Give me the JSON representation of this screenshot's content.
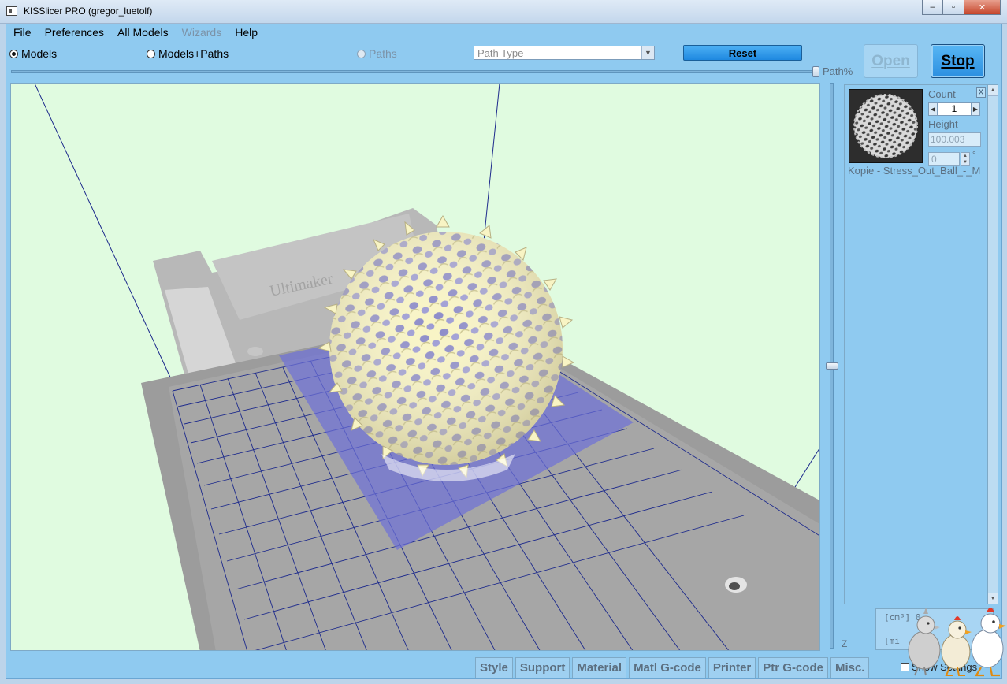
{
  "window": {
    "title": "KISSlicer PRO (gregor_luetolf)",
    "min_glyph": "‒",
    "max_glyph": "▫",
    "close_glyph": "✕"
  },
  "menu": [
    {
      "label": "File",
      "enabled": true
    },
    {
      "label": "Preferences",
      "enabled": true
    },
    {
      "label": "All Models",
      "enabled": true
    },
    {
      "label": "Wizards",
      "enabled": false
    },
    {
      "label": "Help",
      "enabled": true
    }
  ],
  "toolbar": {
    "radio_models": "Models",
    "radio_models_paths": "Models+Paths",
    "radio_paths": "Paths",
    "selected_view": "Models",
    "path_type_select": "Path Type",
    "reset_label": "Reset",
    "open_label": "Open",
    "stop_label": "Stop",
    "path_slider_label": "Path%",
    "path_slider_value_percent": 100
  },
  "z_slider": {
    "label": "Z",
    "value_fraction": 0.5
  },
  "model": {
    "count_label": "Count",
    "count_value": "1",
    "height_label": "Height",
    "height_value": "100.003",
    "rotation_value": "0",
    "degree_symbol": "°",
    "close_label": "X",
    "name": "Kopie - Stress_Out_Ball_-_M"
  },
  "cost": {
    "row1": "[cm³] 0",
    "row2": "[mi"
  },
  "show_settings_label": "Show Settings",
  "show_settings_checked": false,
  "tabs": [
    "Style",
    "Support",
    "Material",
    "Matl G-code",
    "Printer",
    "Ptr G-code",
    "Misc."
  ],
  "colors": {
    "frame": "#8fcaf0",
    "viewport": "#e0fbe0",
    "bed_grid": "#1d2a8c",
    "model": "#fbf7c9",
    "shadow": "#7b7fd0"
  },
  "icons": {
    "app": "kisslicer-app-icon",
    "dropdown": "chevron-down-icon",
    "mascot": "chicken-mascot-icon"
  }
}
